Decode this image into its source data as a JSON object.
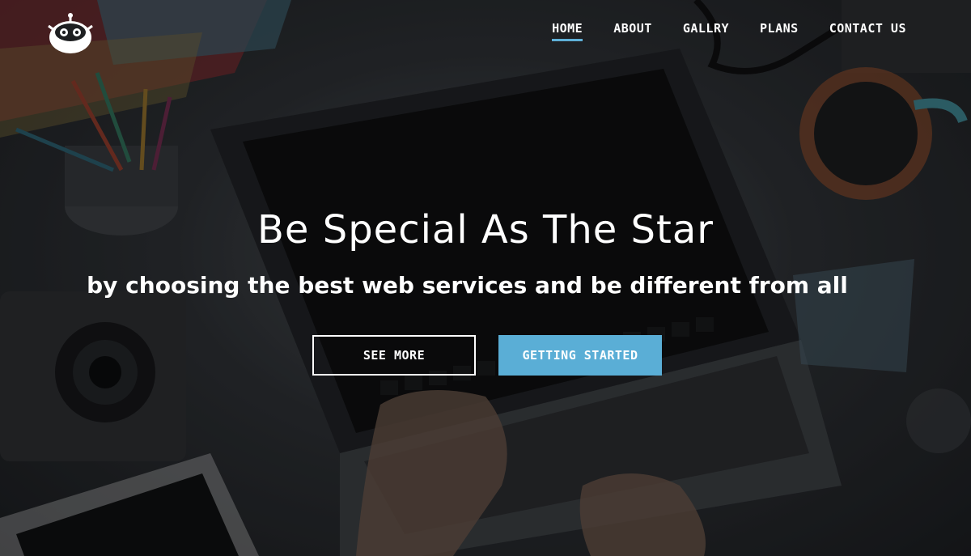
{
  "nav": {
    "items": [
      {
        "label": "HOME",
        "active": true
      },
      {
        "label": "ABOUT",
        "active": false
      },
      {
        "label": "GALLRY",
        "active": false
      },
      {
        "label": "PLANS",
        "active": false
      },
      {
        "label": "CONTACT US",
        "active": false
      }
    ]
  },
  "hero": {
    "headline": "Be Special As The Star",
    "subline": "by choosing the best web services and be different from all",
    "buttons": {
      "see_more": "SEE MORE",
      "getting_started": "GETTING STARTED"
    }
  },
  "colors": {
    "accent": "#5aaed6",
    "text": "#ffffff",
    "overlay": "#1b1d20"
  },
  "icons": {
    "logo": "robot-logo-icon"
  }
}
